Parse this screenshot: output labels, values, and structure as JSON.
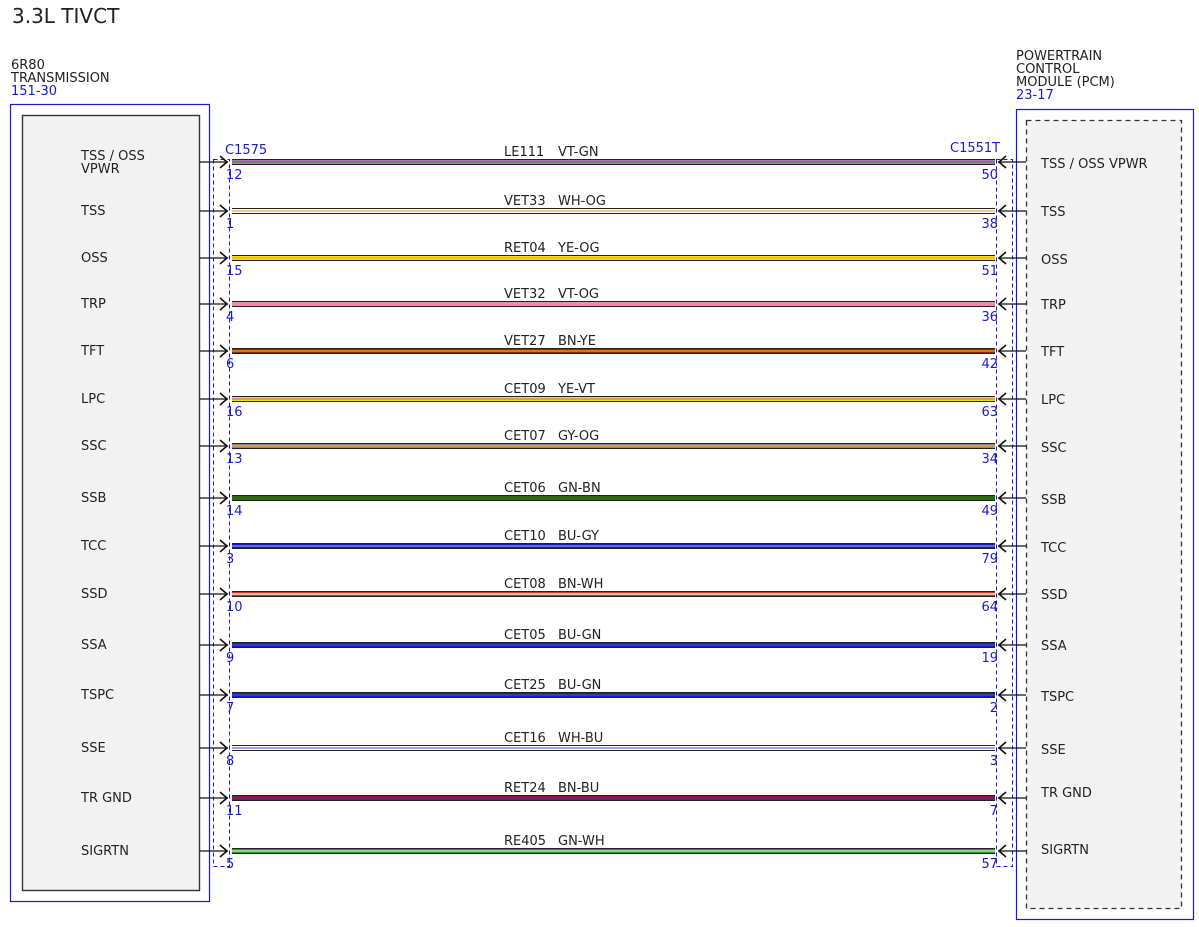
{
  "title": "3.3L TIVCT",
  "left_component": {
    "name_lines": [
      "6R80",
      "TRANSMISSION"
    ],
    "ref": "151-30",
    "connector": "C1575"
  },
  "right_component": {
    "name_lines": [
      "POWERTRAIN",
      "CONTROL",
      "MODULE (PCM)"
    ],
    "ref": "23-17",
    "connector": "C1551T"
  },
  "colors": {
    "outline_blue": "#1a1acc",
    "box_fill": "#f2f2f2"
  },
  "wires": [
    {
      "left_label": [
        "TSS / OSS",
        "VPWR"
      ],
      "left_pin": "12",
      "circuit": "LE111",
      "color_code": "VT-GN",
      "right_pin": "50",
      "right_label": "TSS / OSS VPWR",
      "base": "#b07ab8",
      "stripe": "#4a8a3a"
    },
    {
      "left_label": [
        "TSS"
      ],
      "left_pin": "1",
      "circuit": "VET33",
      "color_code": "WH-OG",
      "right_pin": "38",
      "right_label": "TSS",
      "base": "#ffffff",
      "stripe": "#f0a640"
    },
    {
      "left_label": [
        "OSS"
      ],
      "left_pin": "15",
      "circuit": "RET04",
      "color_code": "YE-OG",
      "right_pin": "51",
      "right_label": "OSS",
      "base": "#f5e100",
      "stripe": "#f0a640"
    },
    {
      "left_label": [
        "TRP"
      ],
      "left_pin": "4",
      "circuit": "VET32",
      "color_code": "VT-OG",
      "right_pin": "36",
      "right_label": "TRP",
      "base": "#f08ab0",
      "stripe": "#f08ab0"
    },
    {
      "left_label": [
        "TFT"
      ],
      "left_pin": "6",
      "circuit": "VET27",
      "color_code": "BN-YE",
      "right_pin": "42",
      "right_label": "TFT",
      "base": "#8a2a10",
      "stripe": "#f0b000"
    },
    {
      "left_label": [
        "LPC"
      ],
      "left_pin": "16",
      "circuit": "CET09",
      "color_code": "YE-VT",
      "right_pin": "63",
      "right_label": "LPC",
      "base": "#f5e100",
      "stripe": "#b07ab8"
    },
    {
      "left_label": [
        "SSC"
      ],
      "left_pin": "13",
      "circuit": "CET07",
      "color_code": "GY-OG",
      "right_pin": "34",
      "right_label": "SSC",
      "base": "#8c8c8c",
      "stripe": "#f0a640"
    },
    {
      "left_label": [
        "SSB"
      ],
      "left_pin": "14",
      "circuit": "CET06",
      "color_code": "GN-BN",
      "right_pin": "49",
      "right_label": "SSB",
      "base": "#2e6a10",
      "stripe": "#2e6a10"
    },
    {
      "left_label": [
        "TCC"
      ],
      "left_pin": "3",
      "circuit": "CET10",
      "color_code": "BU-GY",
      "right_pin": "79",
      "right_label": "TCC",
      "base": "#1a1acc",
      "stripe": "#9a9ad0"
    },
    {
      "left_label": [
        "SSD"
      ],
      "left_pin": "10",
      "circuit": "CET08",
      "color_code": "BN-WH",
      "right_pin": "64",
      "right_label": "SSD",
      "base": "#c0392b",
      "stripe": "#ffffff"
    },
    {
      "left_label": [
        "SSA"
      ],
      "left_pin": "9",
      "circuit": "CET05",
      "color_code": "BU-GN",
      "right_pin": "19",
      "right_label": "SSA",
      "base": "#1a1acc",
      "stripe": "#3a5a8a"
    },
    {
      "left_label": [
        "TSPC"
      ],
      "left_pin": "7",
      "circuit": "CET25",
      "color_code": "BU-GN",
      "right_pin": "2",
      "right_label": "TSPC",
      "base": "#1a1acc",
      "stripe": "#3a5a8a"
    },
    {
      "left_label": [
        "SSE"
      ],
      "left_pin": "8",
      "circuit": "CET16",
      "color_code": "WH-BU",
      "right_pin": "3",
      "right_label": "SSE",
      "base": "#ffffff",
      "stripe": "#6a6ae0"
    },
    {
      "left_label": [
        "TR GND"
      ],
      "left_pin": "11",
      "circuit": "RET24",
      "color_code": "BN-BU",
      "right_pin": "7",
      "right_label": "TR GND",
      "base": "#8a1a3a",
      "stripe": "#5a2a8a"
    },
    {
      "left_label": [
        "SIGRTN"
      ],
      "left_pin": "5",
      "circuit": "RE405",
      "color_code": "GN-WH",
      "right_pin": "57",
      "right_label": "SIGRTN",
      "base": "#2a9a2a",
      "stripe": "#c8f0c8"
    }
  ]
}
